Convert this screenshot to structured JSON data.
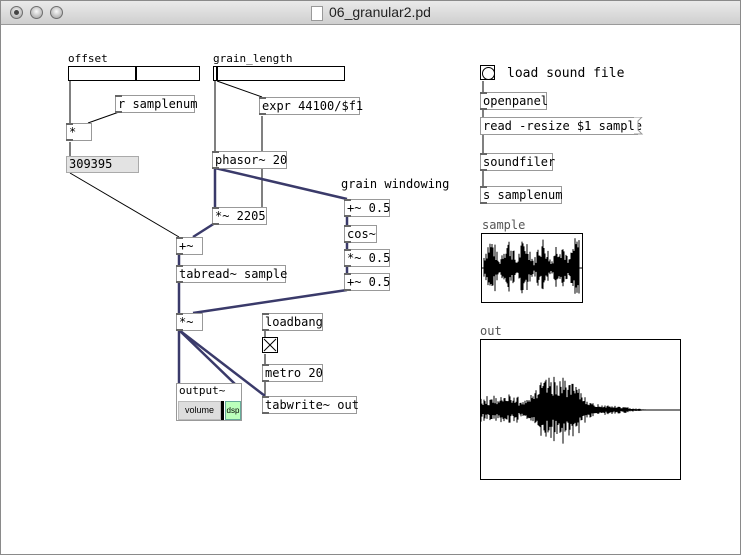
{
  "window": {
    "title": "06_granular2.pd",
    "buttons": [
      "close",
      "minimize",
      "zoom"
    ]
  },
  "sliders": {
    "offset": {
      "label": "offset",
      "level": 0.5
    },
    "grain_length": {
      "label": "grain_length",
      "level": 0.02
    }
  },
  "objects": {
    "r_samplenum": "r samplenum",
    "mult": "*",
    "expr": "expr 44100/$f1",
    "phasor": "phasor~ 20",
    "mult_2205": "*~ 2205",
    "add_tilde": "+~",
    "tabread": "tabread~ sample",
    "mult_tilde": "*~",
    "plus05a": "+~ 0.5",
    "cos": "cos~",
    "mult05": "*~ 0.5",
    "plus05b": "+~ 0.5",
    "loadbang": "loadbang",
    "metro": "metro 20",
    "tabwrite": "tabwrite~ out",
    "openpanel": "openpanel",
    "soundfiler": "soundfiler",
    "s_samplenum": "s samplenum"
  },
  "number_box": "309395",
  "comments": {
    "grain_windowing": "grain windowing",
    "load_sound_file": "load sound file"
  },
  "messages": {
    "read": "read -resize $1 sample"
  },
  "arrays": {
    "sample": "sample",
    "out": "out"
  },
  "output": {
    "title": "output~",
    "volume": "volume",
    "dsp": "dsp"
  },
  "colors": {
    "signal_cord": "#3a3a6a",
    "control_cord": "#000000"
  }
}
